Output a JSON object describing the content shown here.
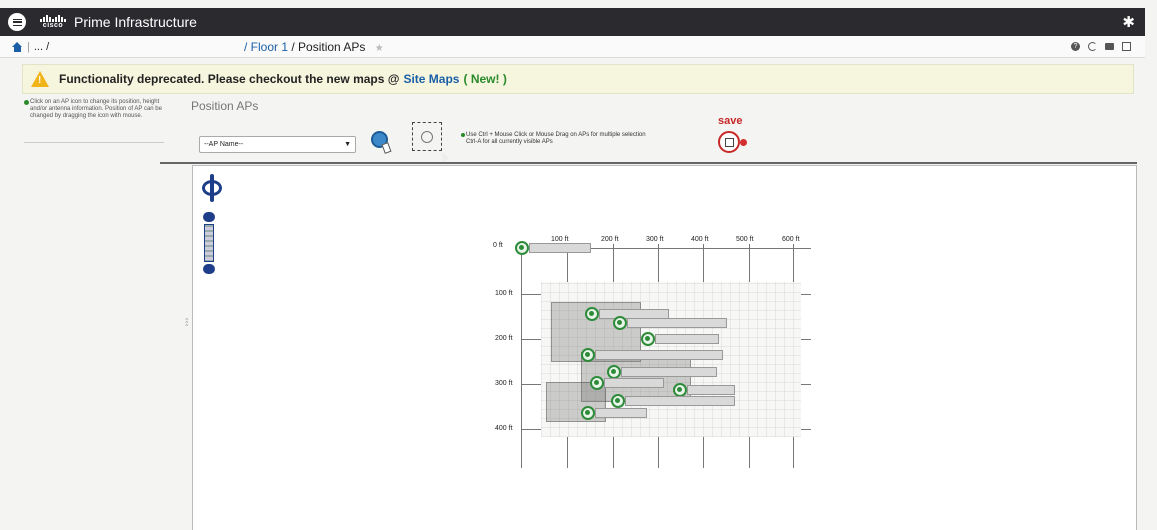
{
  "header": {
    "brand": "cisco",
    "app_title": "Prime Infrastructure",
    "menu_icon": "hamburger-menu-icon",
    "settings_icon": "gear-icon"
  },
  "breadcrumb": {
    "ellipsis": "... /",
    "floor": "/ Floor 1",
    "page": "/ Position APs",
    "favorite_icon": "star-icon",
    "right_icons": [
      "help-icon",
      "refresh-icon",
      "comment-icon",
      "window-icon"
    ]
  },
  "banner": {
    "message": "Functionality deprecated. Please checkout the new maps @",
    "link_text": "Site Maps",
    "new_text": "( New! )"
  },
  "help_text": "Click on an AP icon to change its position, height and/or antenna information. Position of AP can be changed by dragging the icon with mouse.",
  "toolbar": {
    "section_title": "Position APs",
    "ap_select_value": "--AP Name--",
    "hint_line1": "Use Ctrl + Mouse Click or Mouse Drag on APs for multiple selection",
    "hint_line2": "Ctrl-A for all currently visible APs",
    "save_label": "save"
  },
  "map": {
    "x_ticks": [
      "0 ft",
      "100 ft",
      "200 ft",
      "300 ft",
      "400 ft",
      "500 ft",
      "600 ft"
    ],
    "y_ticks": [
      "100 ft",
      "200 ft",
      "300 ft",
      "400 ft"
    ],
    "collapse_glyph": "‹‹‹"
  }
}
